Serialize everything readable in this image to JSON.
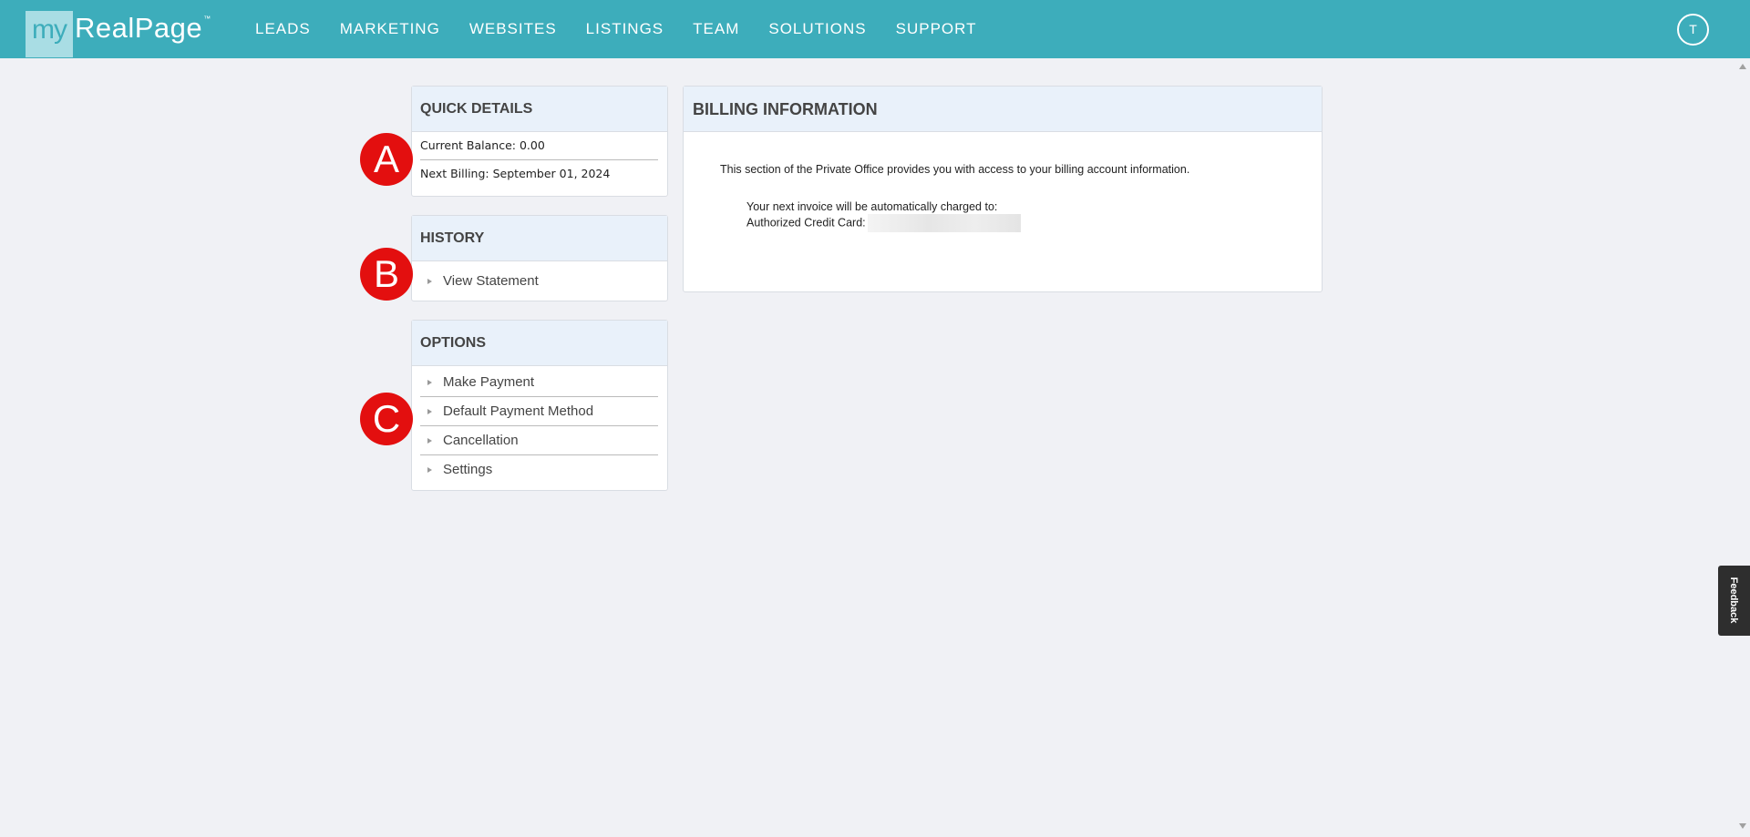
{
  "brand": {
    "logo_my": "my",
    "logo_name": "RealPage",
    "logo_tm": "™"
  },
  "nav": {
    "items": [
      {
        "label": "LEADS"
      },
      {
        "label": "MARKETING"
      },
      {
        "label": "WEBSITES"
      },
      {
        "label": "LISTINGS"
      },
      {
        "label": "TEAM"
      },
      {
        "label": "SOLUTIONS"
      },
      {
        "label": "SUPPORT"
      }
    ],
    "avatar_initial": "T"
  },
  "quick_details": {
    "title": "QUICK DETAILS",
    "current_balance": "Current Balance: 0.00",
    "next_billing": "Next Billing: September 01, 2024"
  },
  "history": {
    "title": "HISTORY",
    "items": [
      {
        "label": "View Statement"
      }
    ]
  },
  "options": {
    "title": "OPTIONS",
    "items": [
      {
        "label": "Make Payment"
      },
      {
        "label": "Default Payment Method"
      },
      {
        "label": "Cancellation"
      },
      {
        "label": "Settings"
      }
    ]
  },
  "billing": {
    "title": "BILLING INFORMATION",
    "intro": "This section of the Private Office provides you with access to your billing account information.",
    "invoice_line": "Your next invoice will be automatically charged to:",
    "card_label": "Authorized Credit Card:"
  },
  "markers": {
    "a": "A",
    "b": "B",
    "c": "C"
  },
  "feedback_label": "Feedback",
  "colors": {
    "topbar": "#3dadbb",
    "marker": "#e30f0f",
    "panel_header": "#e9f1fa"
  }
}
